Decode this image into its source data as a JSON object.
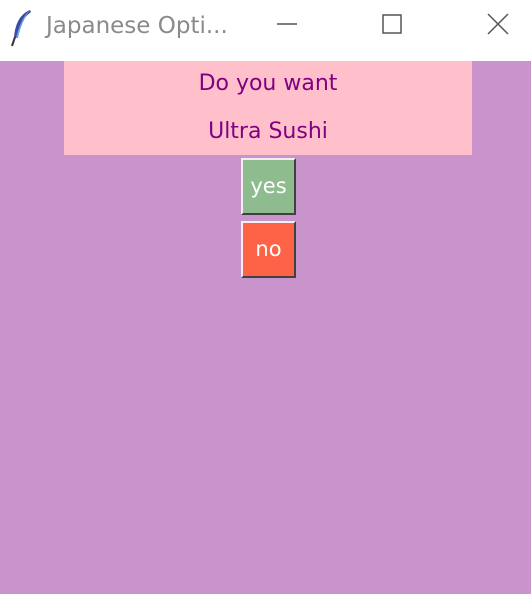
{
  "window": {
    "title": "Japanese Opti..."
  },
  "icons": {
    "app": "feather-icon",
    "minimize": "minimize-icon",
    "maximize": "maximize-icon",
    "close": "close-icon"
  },
  "question": {
    "line1": "Do you want",
    "line2": "Ultra Sushi"
  },
  "buttons": {
    "yes_label": "yes",
    "no_label": "no"
  },
  "colors": {
    "background": "#c994cb",
    "label_background": "#ffc0cb",
    "label_text": "#800080",
    "yes_button": "#8fbc8f",
    "no_button": "#ff6347",
    "button_text": "#ffffff"
  }
}
